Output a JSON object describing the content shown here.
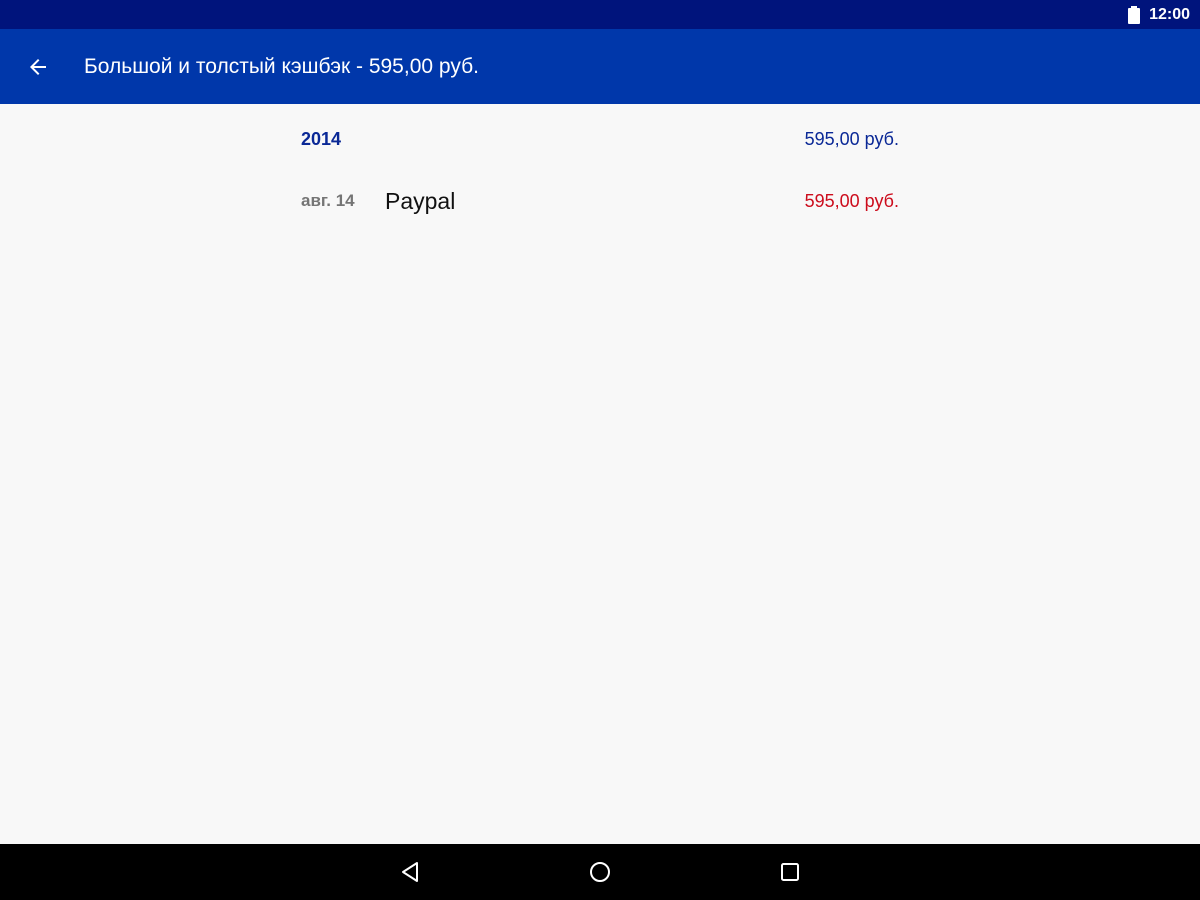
{
  "status_bar": {
    "time": "12:00",
    "battery_icon": "battery-full-icon"
  },
  "app_bar": {
    "back_icon": "arrow-left-icon",
    "title": "Большой и толстый кэшбэк - 595,00 руб."
  },
  "summary": {
    "year": "2014",
    "year_total": "595,00 руб."
  },
  "transactions": [
    {
      "date": "авг. 14",
      "name": "Paypal",
      "amount": "595,00 руб."
    }
  ],
  "nav_bar": {
    "back_icon": "triangle-back-icon",
    "home_icon": "circle-home-icon",
    "recents_icon": "square-recents-icon"
  },
  "colors": {
    "status_bar": "#00147c",
    "app_bar": "#0037aa",
    "year_text": "#0a2896",
    "amount_negative": "#cc0c1c",
    "background": "#f8f8f8"
  }
}
